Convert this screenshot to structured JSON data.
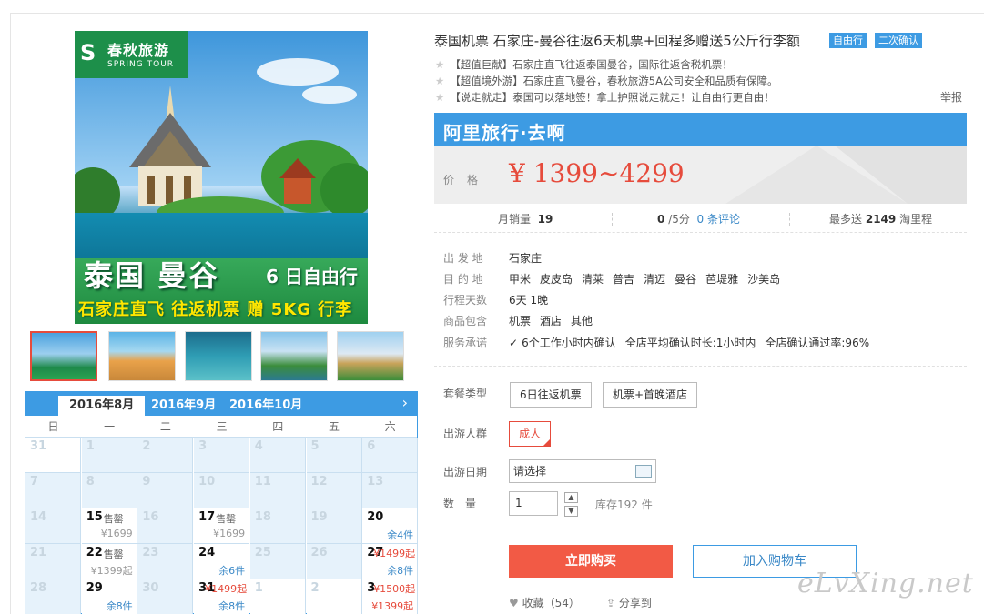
{
  "gallery": {
    "logo_cn": "春秋旅游",
    "logo_en": "SPRING TOUR",
    "image_title": "泰国 曼谷",
    "image_sub": "6 日自由行",
    "image_bottom": "石家庄直飞  往返机票 赠 5KG 行李额"
  },
  "calendar": {
    "months": [
      "2016年8月",
      "2016年9月",
      "2016年10月"
    ],
    "next_icon": "›",
    "weekdays": [
      "日",
      "一",
      "二",
      "三",
      "四",
      "五",
      "六"
    ],
    "rows": [
      [
        {
          "d": "31",
          "white": true
        },
        {
          "d": "1"
        },
        {
          "d": "2"
        },
        {
          "d": "3"
        },
        {
          "d": "4"
        },
        {
          "d": "5"
        },
        {
          "d": "6"
        }
      ],
      [
        {
          "d": "7"
        },
        {
          "d": "8"
        },
        {
          "d": "9"
        },
        {
          "d": "10"
        },
        {
          "d": "11"
        },
        {
          "d": "12"
        },
        {
          "d": "13"
        }
      ],
      [
        {
          "d": "14"
        },
        {
          "d": "15",
          "has": true,
          "white": true,
          "tag": "售罄",
          "price": "¥1699"
        },
        {
          "d": "16"
        },
        {
          "d": "17",
          "has": true,
          "white": true,
          "tag": "售罄",
          "price": "¥1699"
        },
        {
          "d": "18"
        },
        {
          "d": "19"
        },
        {
          "d": "20",
          "has": true,
          "white": true,
          "stock": "余4件"
        }
      ],
      [
        {
          "d": "21"
        },
        {
          "d": "22",
          "has": true,
          "white": true,
          "tag": "售罄",
          "price": "¥1399起"
        },
        {
          "d": "23"
        },
        {
          "d": "24",
          "has": true,
          "white": true,
          "stock": "余6件"
        },
        {
          "d": "25"
        },
        {
          "d": "26"
        },
        {
          "d": "27",
          "has": true,
          "white": true,
          "redtop": "¥1499起",
          "stock": "余8件"
        }
      ],
      [
        {
          "d": "28"
        },
        {
          "d": "29",
          "has": true,
          "white": true,
          "stock": "余8件"
        },
        {
          "d": "30"
        },
        {
          "d": "31",
          "has": true,
          "white": true,
          "redtop": "¥1499起",
          "stock": "余8件"
        },
        {
          "d": "1",
          "white": true
        },
        {
          "d": "2",
          "white": true
        },
        {
          "d": "3",
          "has": true,
          "white": true,
          "redtop": "¥1500起",
          "price_red": "¥1399起"
        }
      ]
    ]
  },
  "product": {
    "title": "泰国机票 石家庄-曼谷往返6天机票+回程多赠送5公斤行李额",
    "badges": [
      "自由行",
      "二次确认"
    ],
    "highlights": [
      "【超值巨献】石家庄直飞往返泰国曼谷，国际往返含税机票！",
      "【超值境外游】石家庄直飞曼谷，春秋旅游5A公司安全和品质有保障。",
      "【说走就走】泰国可以落地签！拿上护照说走就走！让自由行更自由！"
    ],
    "report": "举报",
    "ali_banner": "阿里旅行·去啊",
    "price_label": "价格",
    "price": "¥ 1399~4299",
    "stats": {
      "monthly_label": "月销量",
      "monthly": "19",
      "rating": "0",
      "rating_suffix": "/5分",
      "reviews": "0 条评论",
      "points_prefix": "最多送",
      "points": "2149",
      "points_suffix": "淘里程"
    },
    "info": [
      {
        "k": "出 发 地",
        "v": [
          "石家庄"
        ]
      },
      {
        "k": "目 的 地",
        "v": [
          "甲米",
          "皮皮岛",
          "清莱",
          "普吉",
          "清迈",
          "曼谷",
          "芭堤雅",
          "沙美岛"
        ]
      },
      {
        "k": "行程天数",
        "v": [
          "6天 1晚"
        ]
      },
      {
        "k": "商品包含",
        "v": [
          "机票",
          "酒店",
          "其他"
        ]
      },
      {
        "k": "服务承诺",
        "v": [
          "6个工作小时内确认",
          "全店平均确认时长:1小时内",
          "全店确认通过率:96%"
        ]
      }
    ],
    "package_label": "套餐类型",
    "packages": [
      "6日往返机票",
      "机票+首晚酒店"
    ],
    "crowd_label": "出游人群",
    "crowd": "成人",
    "date_label": "出游日期",
    "date_placeholder": "请选择",
    "qty_label": "数　量",
    "qty": "1",
    "stock": "库存192 件",
    "buy": "立即购买",
    "cart": "加入购物车",
    "fav": "收藏（54）",
    "share": "分享到",
    "watermark": "eLvXing.net"
  },
  "colors": {
    "accent": "#3d9be3",
    "price_red": "#e64b3c",
    "buy_red": "#f25a45"
  }
}
